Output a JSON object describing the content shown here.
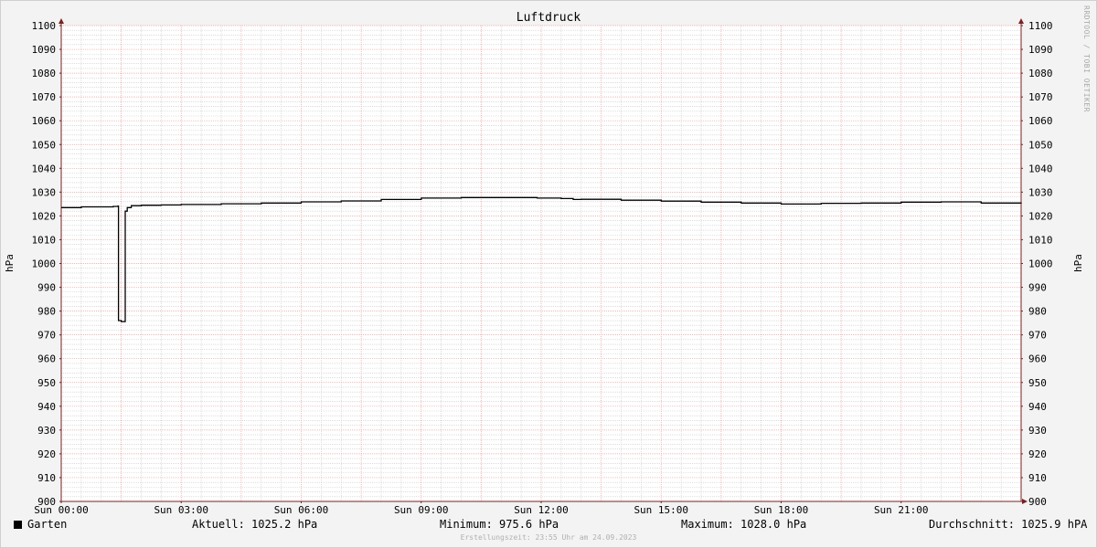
{
  "chart_data": {
    "type": "line",
    "title": "Luftdruck",
    "ylabel_left": "hPa",
    "ylabel_right": "hPa",
    "ylim": [
      900,
      1100
    ],
    "y_ticks": [
      900,
      910,
      920,
      930,
      940,
      950,
      960,
      970,
      980,
      990,
      1000,
      1010,
      1020,
      1030,
      1040,
      1050,
      1060,
      1070,
      1080,
      1090,
      1100
    ],
    "xlim": [
      0,
      24
    ],
    "x_ticks": [
      {
        "x": 0,
        "label": "Sun 00:00"
      },
      {
        "x": 3,
        "label": "Sun 03:00"
      },
      {
        "x": 6,
        "label": "Sun 06:00"
      },
      {
        "x": 9,
        "label": "Sun 09:00"
      },
      {
        "x": 12,
        "label": "Sun 12:00"
      },
      {
        "x": 15,
        "label": "Sun 15:00"
      },
      {
        "x": 18,
        "label": "Sun 18:00"
      },
      {
        "x": 21,
        "label": "Sun 21:00"
      }
    ],
    "grid": true,
    "series": [
      {
        "name": "Garten",
        "color": "#000000",
        "points": [
          [
            0.0,
            1023.5
          ],
          [
            0.5,
            1023.8
          ],
          [
            1.3,
            1024.0
          ],
          [
            1.42,
            1024.2
          ],
          [
            1.43,
            976.0
          ],
          [
            1.5,
            975.6
          ],
          [
            1.6,
            1022.0
          ],
          [
            1.65,
            1023.5
          ],
          [
            1.75,
            1024.3
          ],
          [
            2.0,
            1024.5
          ],
          [
            2.5,
            1024.6
          ],
          [
            3.0,
            1024.8
          ],
          [
            4.0,
            1025.1
          ],
          [
            5.0,
            1025.4
          ],
          [
            6.0,
            1025.9
          ],
          [
            7.0,
            1026.3
          ],
          [
            8.0,
            1026.9
          ],
          [
            9.0,
            1027.5
          ],
          [
            10.0,
            1027.7
          ],
          [
            11.0,
            1027.7
          ],
          [
            11.9,
            1027.5
          ],
          [
            12.5,
            1027.3
          ],
          [
            12.8,
            1026.9
          ],
          [
            13.0,
            1027.0
          ],
          [
            14.0,
            1026.6
          ],
          [
            15.0,
            1026.2
          ],
          [
            16.0,
            1025.8
          ],
          [
            17.0,
            1025.4
          ],
          [
            18.0,
            1025.0
          ],
          [
            19.0,
            1025.3
          ],
          [
            20.0,
            1025.4
          ],
          [
            21.0,
            1025.8
          ],
          [
            22.0,
            1025.9
          ],
          [
            23.0,
            1025.4
          ],
          [
            24.0,
            1025.2
          ]
        ]
      }
    ]
  },
  "legend": {
    "series_name": "Garten",
    "current": "Aktuell: 1025.2 hPa",
    "minimum": "Minimum: 975.6 hPa",
    "maximum": "Maximum: 1028.0 hPa",
    "average": "Durchschnitt: 1025.9 hPA"
  },
  "footer": "Erstellungszeit: 23:55 Uhr am 24.09.2023",
  "credit": "RRDTOOL / TOBI OETIKER",
  "colors": {
    "major_grid": "#e8a0a0",
    "minor_grid": "#c8c8c8",
    "axis": "#7a2020",
    "line": "#000000",
    "plot_bg": "#ffffff",
    "canvas_bg": "#f3f3f3"
  }
}
